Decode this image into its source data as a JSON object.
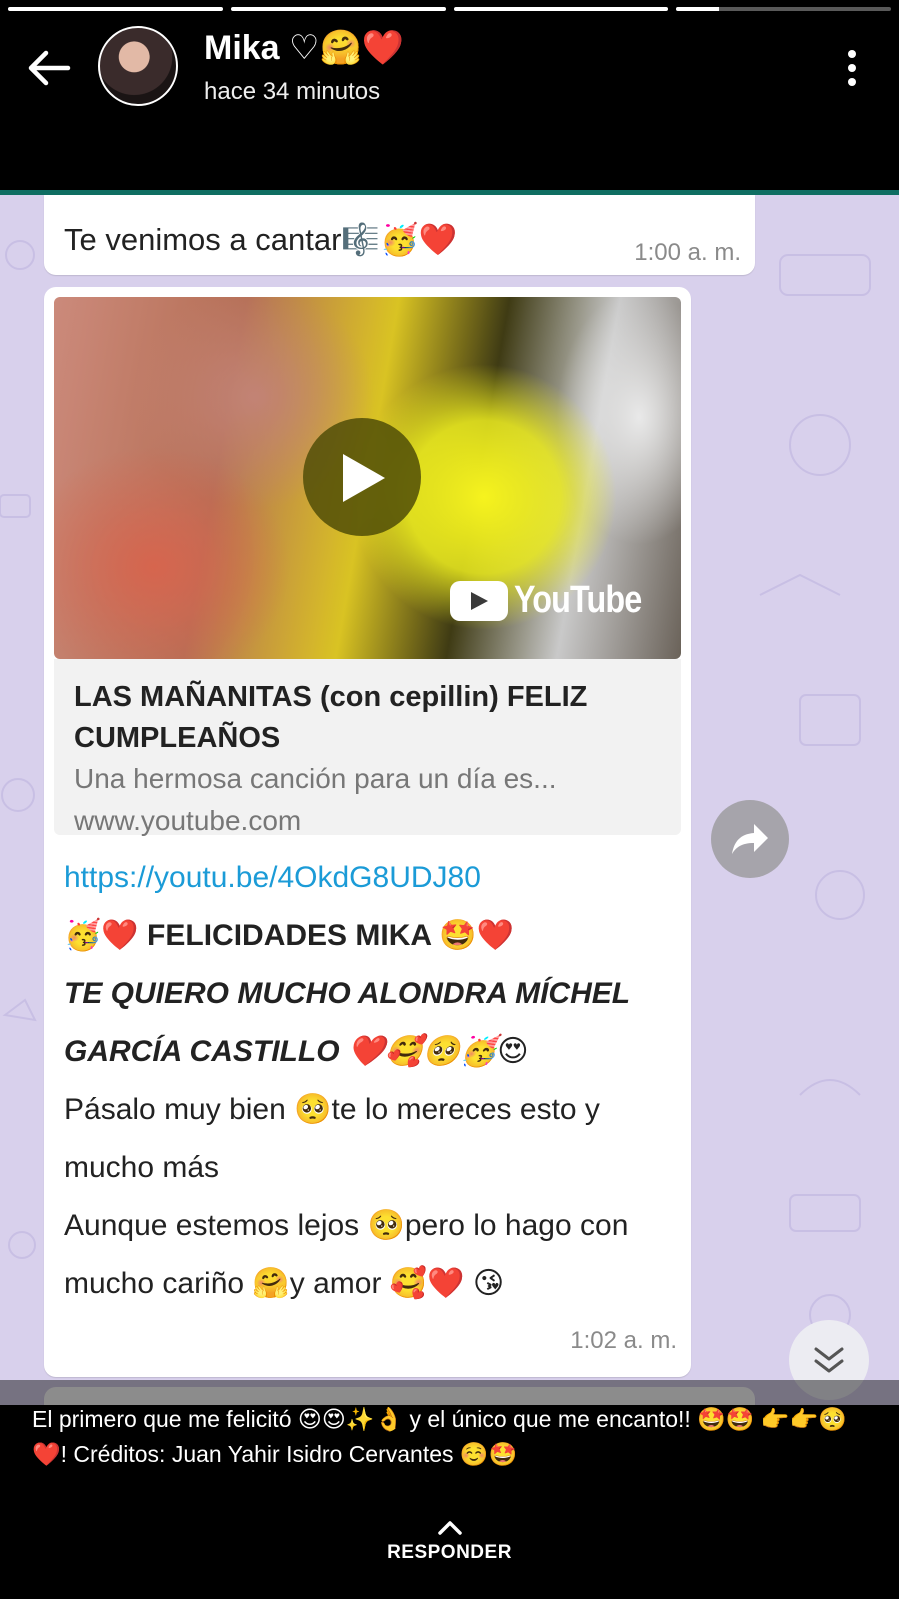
{
  "status": {
    "progress": [
      1,
      1,
      1,
      0.2
    ]
  },
  "header": {
    "contact_name": "Mika ♡🤗❤️",
    "time_ago": "hace 34 minutos",
    "back_icon": "arrow-left",
    "menu_icon": "more-vertical"
  },
  "chat": {
    "message1": {
      "text": "Te venimos a cantar🎼🥳❤️",
      "time": "1:00 a. m."
    },
    "message2": {
      "preview": {
        "brand": "YouTube",
        "title": "LAS MAÑANITAS (con cepillin) FELIZ CUMPLEAÑOS",
        "description": "Una hermosa canción para un día es...",
        "domain": "www.youtube.com"
      },
      "link": "https://youtu.be/4OkdG8UDJ80",
      "lines": {
        "line1": "🥳❤️ FELICIDADES MIKA 🤩❤️",
        "line2": "TE QUIERO MUCHO ALONDRA MÍCHEL GARCÍA CASTILLO ❤️🥰🥺🥳😍",
        "line3": "Pásalo muy bien 🥺te lo mereces esto y mucho más",
        "line4": "Aunque estemos lejos 🥺pero lo hago con mucho cariño 🤗y amor 🥰❤️ 😘"
      },
      "time": "1:02 a. m."
    }
  },
  "caption": {
    "text": "El primero que me felicitó 😍😍✨👌  y el único que me encanto!! 🤩🤩 👉👉🥺❤️! Créditos: Juan Yahir Isidro Cervantes ☺️🤩"
  },
  "footer": {
    "reply_label": "RESPONDER"
  },
  "colors": {
    "background": "#000000",
    "chat_wallpaper": "#d8d0ec",
    "link": "#1b9bd7",
    "header_divider": "#0f6e62"
  }
}
